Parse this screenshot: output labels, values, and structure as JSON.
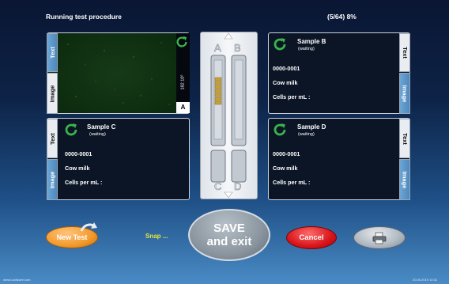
{
  "header": {
    "title": "Running test procedure",
    "progress": "(5/64) 8%"
  },
  "image_panel": {
    "tab_text": "Text",
    "tab_image": "Image",
    "side_value": "182 10⁰",
    "position": "A"
  },
  "samples": {
    "b": {
      "name": "Sample B",
      "status": "(waiting)",
      "id": "0000-0001",
      "type": "Cow milk",
      "cells_label": "Cells per mL :",
      "tab_text": "Text",
      "tab_image": "Image"
    },
    "c": {
      "name": "Sample C",
      "status": "(waiting)",
      "id": "0000-0001",
      "type": "Cow milk",
      "cells_label": "Cells per mL :",
      "tab_text": "Text",
      "tab_image": "Image"
    },
    "d": {
      "name": "Sample D",
      "status": "(waiting)",
      "id": "0000-0001",
      "type": "Cow milk",
      "cells_label": "Cells per mL :",
      "tab_text": "Text",
      "tab_image": "Image"
    }
  },
  "cassette": {
    "label_a": "A",
    "label_b": "B",
    "label_c": "C",
    "label_d": "D"
  },
  "buttons": {
    "new_test": "New Test",
    "snap": "Snap ...",
    "save_line1": "SAVE",
    "save_line2": "and exit",
    "cancel": "Cancel"
  },
  "footer": {
    "left": "www.Lacticare.com",
    "right": "20.06.2019 10:31"
  },
  "colors": {
    "accent_green": "#39b54a",
    "new_test_orange": "#f39a2c",
    "cancel_red": "#d8151a",
    "snap_yellow": "#e6e63c"
  }
}
